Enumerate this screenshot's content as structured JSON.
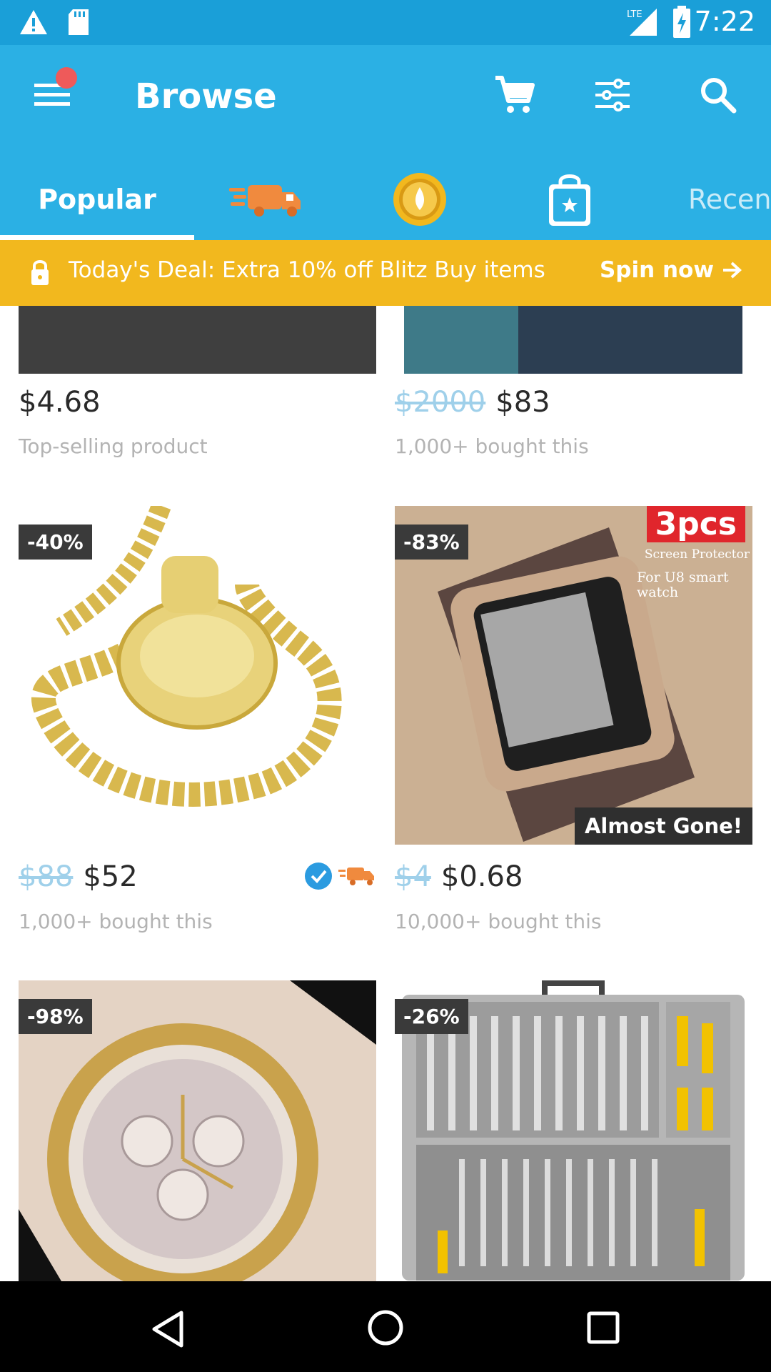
{
  "status_bar": {
    "time": "7:22",
    "network": "LTE"
  },
  "app_bar": {
    "title": "Browse",
    "icons": [
      "menu-icon",
      "cart-icon",
      "filter-icon",
      "search-icon"
    ]
  },
  "tabs": [
    {
      "label": "Popular",
      "selected": true
    },
    {
      "icon": "delivery-truck-icon"
    },
    {
      "icon": "gold-coin-icon"
    },
    {
      "icon": "shopping-bag-icon"
    },
    {
      "label": "Recen"
    }
  ],
  "deal_banner": {
    "text": "Today's Deal: Extra 10% off Blitz Buy items",
    "action": "Spin now"
  },
  "products": [
    {
      "old_price": "",
      "price": "$4.68",
      "subtitle": "Top-selling product"
    },
    {
      "old_price": "$2000",
      "price": "$83",
      "subtitle": "1,000+ bought this"
    },
    {
      "discount": "-40%",
      "old_price": "$88",
      "price": "$52",
      "subtitle": "1,000+ bought this"
    },
    {
      "discount": "-83%",
      "old_price": "$4",
      "price": "$0.68",
      "subtitle": "10,000+ bought this",
      "tag": "Almost Gone!",
      "promo_text": "3pcs",
      "promo_sub": "Screen Protector",
      "promo_sub2": "For U8 smart watch"
    },
    {
      "discount": "-98%"
    },
    {
      "discount": "-26%"
    }
  ],
  "colors": {
    "status_bar": "#1a9fd8",
    "app_bar": "#2bb0e4",
    "deal_banner": "#f2b81e"
  }
}
